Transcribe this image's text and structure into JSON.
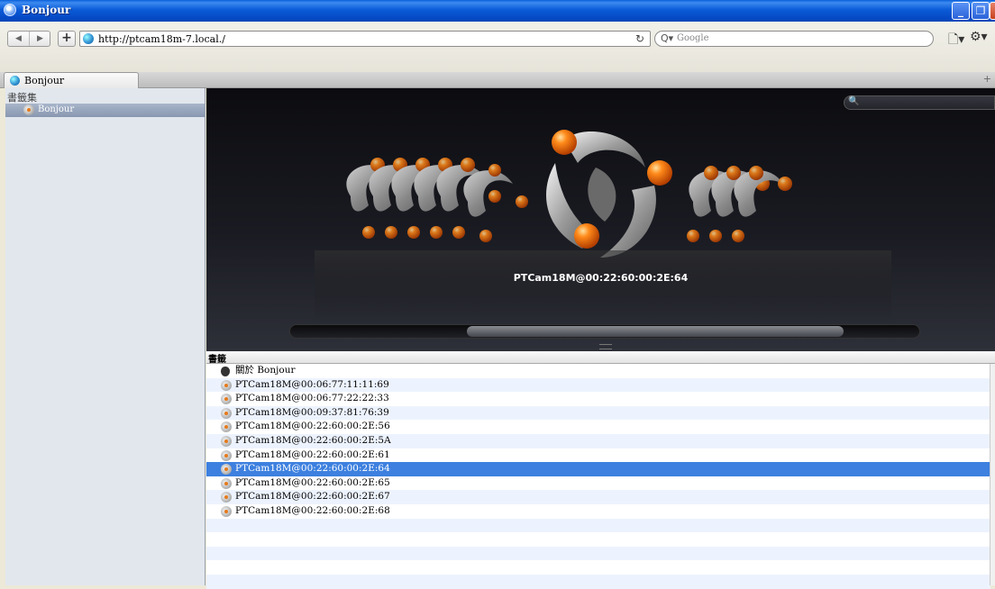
{
  "window": {
    "title": "Bonjour",
    "controls": {
      "minimize": "_",
      "maximize": "❐",
      "close": "✕"
    }
  },
  "toolbar": {
    "back": "◀",
    "forward": "▶",
    "add": "+",
    "address": "http://ptcam18m-7.local./",
    "reload": "↻",
    "search_placeholder": "Google",
    "search_prefix": "Q▾",
    "page_menu": "🗋▾",
    "gear_menu": "⚙▾",
    "glasses": "ꝏ",
    "book": "📖",
    "grid": "▦"
  },
  "tabs": [
    {
      "label": "Bonjour"
    }
  ],
  "tab_new": "+",
  "sidebar": {
    "heading": "書籤集",
    "items": [
      {
        "label": "Bonjour",
        "selected": true
      }
    ]
  },
  "coverflow": {
    "caption": "PTCam18M@00:22:60:00:2E:64",
    "search_icon": "🔍",
    "scroll_fraction": 0.6
  },
  "list": {
    "header": "書籤",
    "rows": [
      {
        "label": "關於 Bonjour",
        "icon": "apple-icon"
      },
      {
        "label": "PTCam18M@00:06:77:11:11:69",
        "icon": "bonjour-icon"
      },
      {
        "label": "PTCam18M@00:06:77:22:22:33",
        "icon": "bonjour-icon"
      },
      {
        "label": "PTCam18M@00:09:37:81:76:39",
        "icon": "bonjour-icon"
      },
      {
        "label": "PTCam18M@00:22:60:00:2E:56",
        "icon": "bonjour-icon"
      },
      {
        "label": "PTCam18M@00:22:60:00:2E:5A",
        "icon": "bonjour-icon"
      },
      {
        "label": "PTCam18M@00:22:60:00:2E:61",
        "icon": "bonjour-icon"
      },
      {
        "label": "PTCam18M@00:22:60:00:2E:64",
        "icon": "bonjour-icon",
        "selected": true
      },
      {
        "label": "PTCam18M@00:22:60:00:2E:65",
        "icon": "bonjour-icon"
      },
      {
        "label": "PTCam18M@00:22:60:00:2E:67",
        "icon": "bonjour-icon"
      },
      {
        "label": "PTCam18M@00:22:60:00:2E:68",
        "icon": "bonjour-icon"
      }
    ],
    "empty_rows": 5
  }
}
